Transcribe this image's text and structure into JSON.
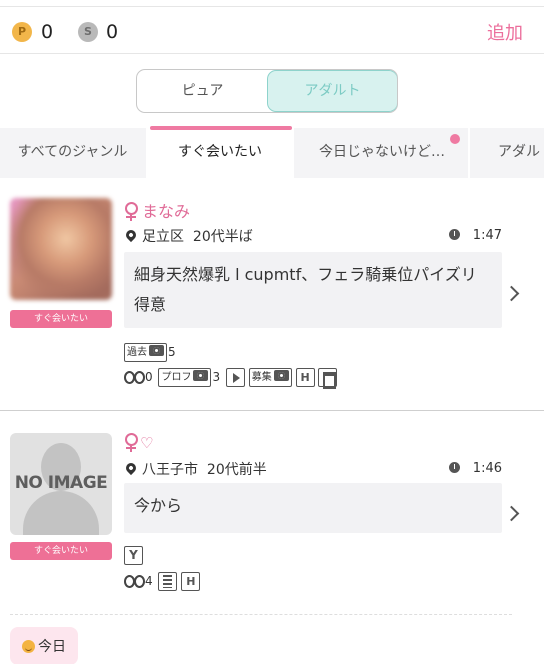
{
  "points": {
    "p_icon": "P",
    "p_value": "0",
    "s_icon": "S",
    "s_value": "0",
    "add_label": "追加"
  },
  "segment": {
    "pure": "ピュア",
    "adult": "アダルト",
    "selected": "アダルト"
  },
  "tabs": {
    "all": "すべてのジャンル",
    "now": "すぐ会いたい",
    "today": "今日じゃないけど…",
    "adult": "アダル",
    "selected": "すぐ会いたい"
  },
  "posts": [
    {
      "badge": "すぐ会いたい",
      "name": "まなみ",
      "location": "足立区",
      "age": "20代半ば",
      "time": "1:47",
      "message": "細身天然爆乳 l cupmtf、フェラ騎乗位パイズリ得意",
      "tags": {
        "past_label": "過去",
        "past_count": "5",
        "views": "0",
        "profile_label": "プロフ",
        "profile_count": "3",
        "recruit_label": "募集"
      }
    },
    {
      "badge": "すぐ会いたい",
      "thumb_text": "NO IMAGE",
      "name": "",
      "location": "八王子市",
      "age": "20代前半",
      "time": "1:46",
      "message": "今から",
      "tags": {
        "views": "4"
      }
    }
  ],
  "filter_chip": "今日",
  "colors": {
    "accent_pink": "#ec6f9c",
    "teal": "#7ccbc4",
    "badge_pink": "#ee7096"
  }
}
